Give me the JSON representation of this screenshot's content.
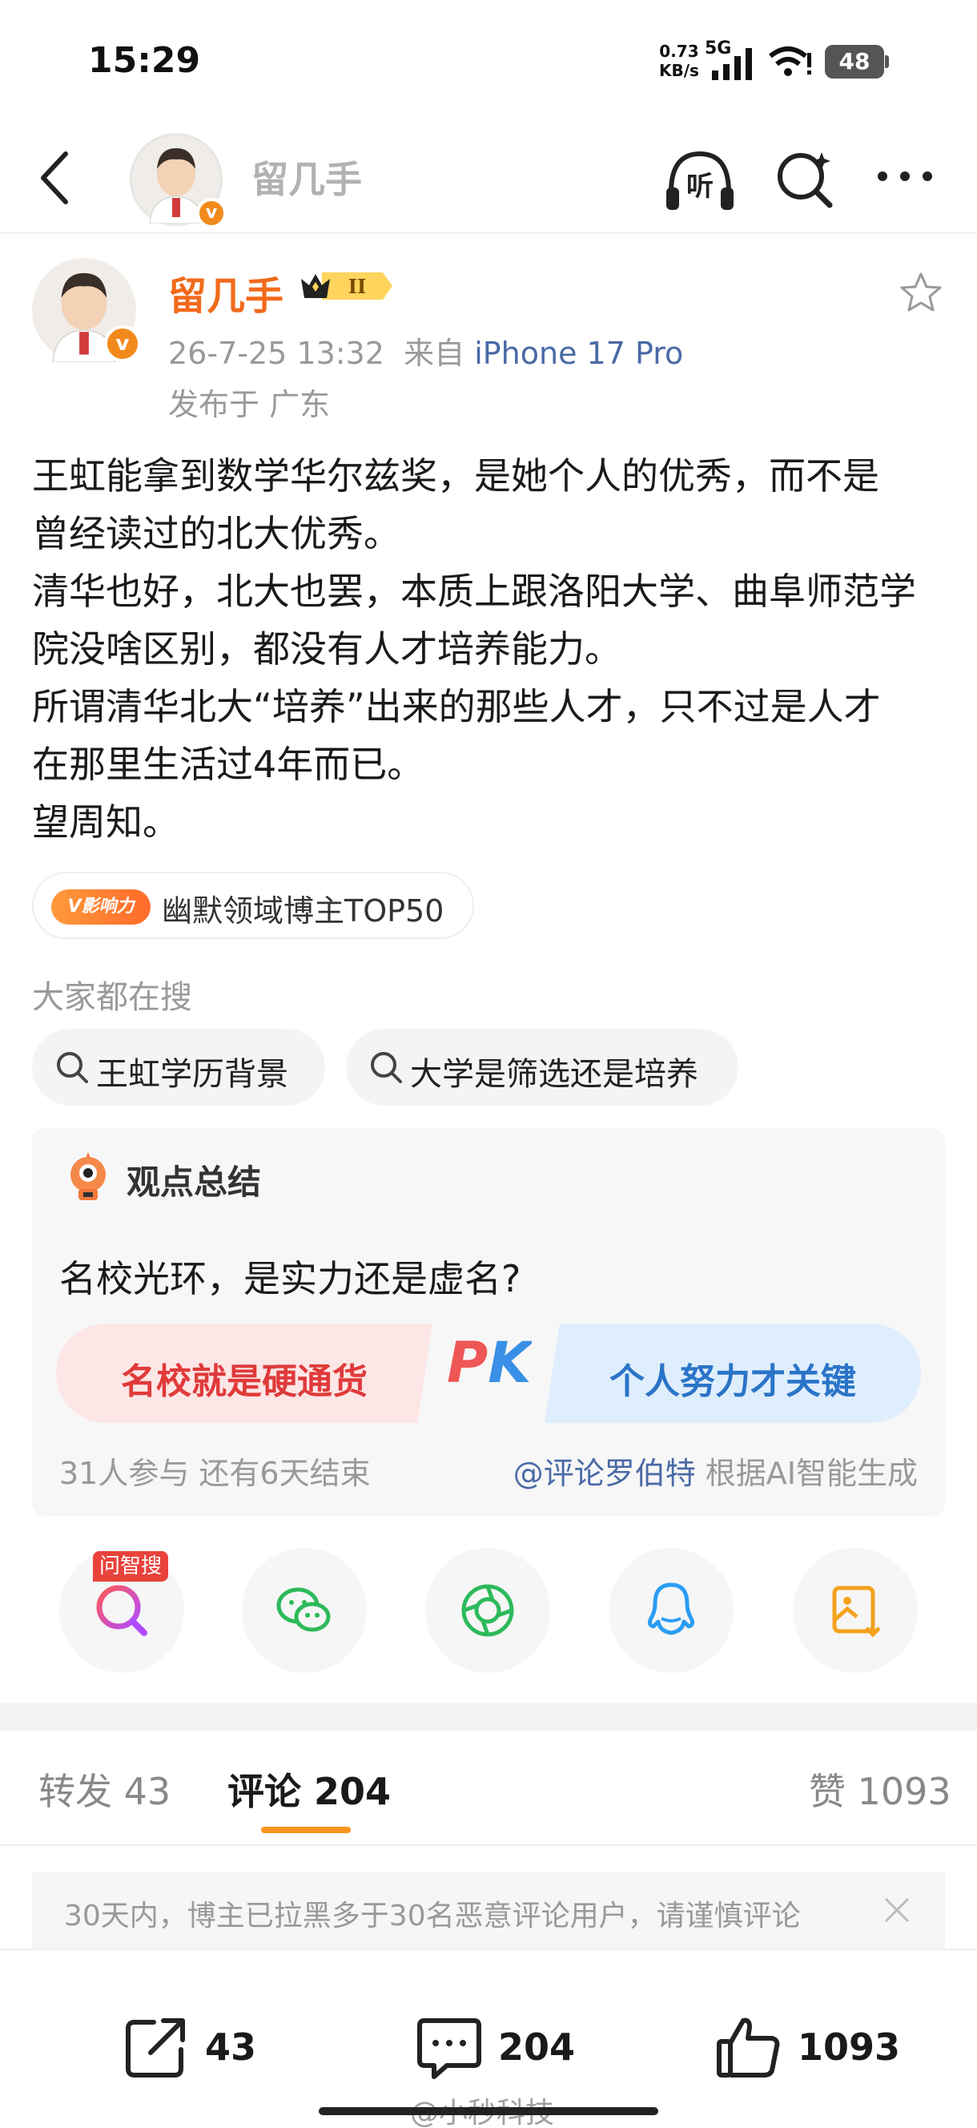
{
  "status_bar": {
    "time": "15:29",
    "net_speed_value": "0.73",
    "net_speed_unit": "KB/s",
    "network": "5G",
    "battery": "48"
  },
  "nav": {
    "title": "留几手",
    "listen_label": "听"
  },
  "author": {
    "name": "留几手",
    "level": "II",
    "date": "26-7-25 13:32",
    "source_prefix": "来自",
    "device": "iPhone 17 Pro",
    "location": "发布于 广东"
  },
  "post": {
    "lines": [
      "王虹能拿到数学华尔兹奖，是她个人的优秀，而不是",
      "曾经读过的北大优秀。",
      "清华也好，北大也罢，本质上跟洛阳大学、曲阜师范学",
      "院没啥区别，都没有人才培养能力。",
      "所谓清华北大“培养”出来的那些人才，只不过是人才",
      "在那里生活过4年而已。",
      "望周知。"
    ]
  },
  "influence": {
    "badge": "V影响力",
    "text": "幽默领域博主TOP50"
  },
  "hot_search": {
    "title": "大家都在搜",
    "chips": [
      "王虹学历背景",
      "大学是筛选还是培养"
    ]
  },
  "opinion": {
    "title": "观点总结",
    "question": "名校光环，是实力还是虚名?",
    "left_option": "名校就是硬通货",
    "pk_label": "PK",
    "right_option": "个人努力才关键",
    "participants": "31人参与  还有6天结束",
    "ai_mention": "@评论罗伯特",
    "ai_suffix": " 根据AI智能生成"
  },
  "share": {
    "ask_badge": "问智搜",
    "items": [
      "ask-search-icon",
      "wechat-icon",
      "moments-icon",
      "qq-icon",
      "save-image-icon"
    ]
  },
  "tabs": {
    "repost": "转发 43",
    "comment": "评论 204",
    "like": "赞 1093"
  },
  "notice": {
    "text": "30天内，博主已拉黑多于30名恶意评论用户，请谨慎评论"
  },
  "bottom": {
    "repost_count": "43",
    "comment_count": "204",
    "like_count": "1093",
    "watermark": "@小秒科技"
  },
  "colors": {
    "accent_orange": "#f26a1b",
    "link_blue": "#4a6aa6",
    "tab_indicator": "#f7951d",
    "pk_red": "#e03a3a",
    "pk_blue": "#2a74c8"
  }
}
